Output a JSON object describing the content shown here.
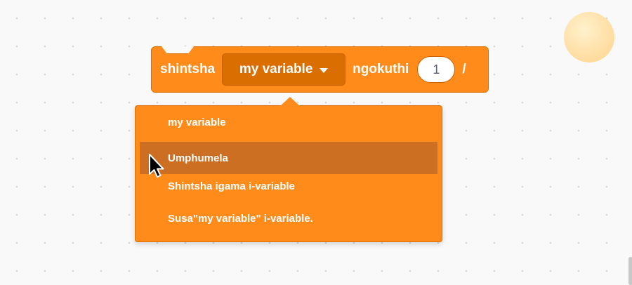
{
  "block": {
    "prefix": "shintsha",
    "variable": "my variable",
    "middle": "ngokuthi",
    "value": "1",
    "suffix": "/"
  },
  "menu": {
    "items": [
      {
        "label": "my variable"
      },
      {
        "label": "Umphumela"
      },
      {
        "label": "Shintsha igama i-variable"
      },
      {
        "label": "Susa\"my variable\" i-variable."
      }
    ],
    "hovered_index": 1
  },
  "colors": {
    "block": "#ff8c1a",
    "block_border": "#db6e00",
    "dropdown": "#db6e00",
    "menu_hover": "#cc6f22",
    "canvas": "#f9f9f9"
  },
  "icons": {
    "dropdown_caret": "caret-down-icon",
    "pointer": "mouse-cursor-icon"
  }
}
